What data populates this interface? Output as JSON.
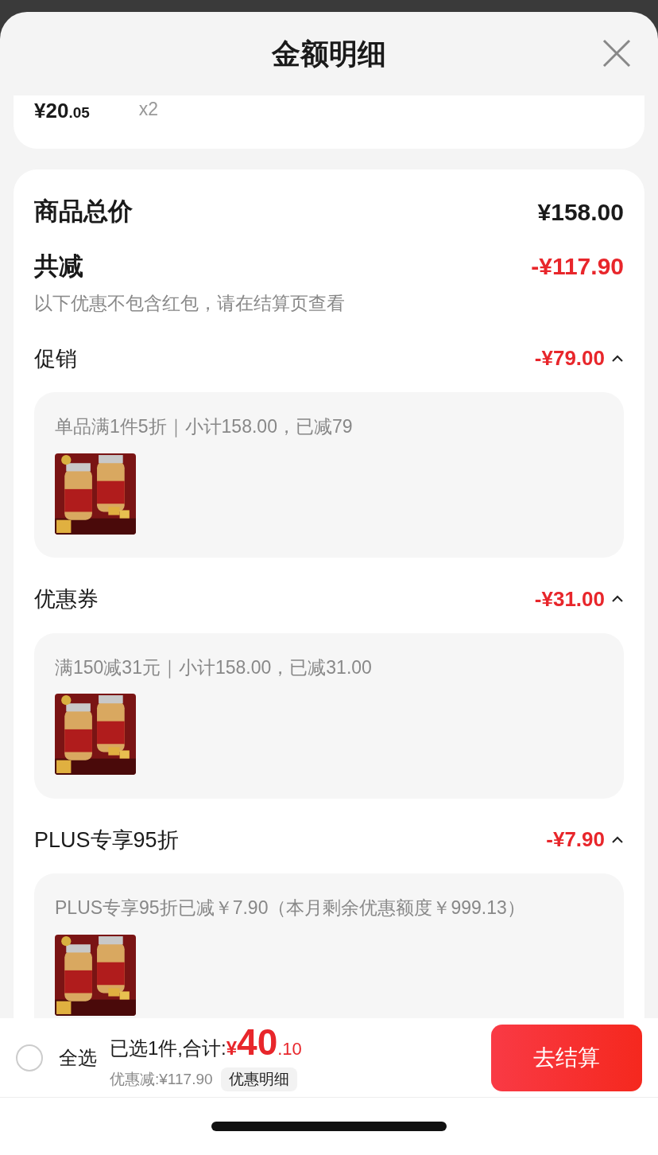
{
  "header": {
    "title": "金额明细"
  },
  "item": {
    "price_main": "¥20",
    "price_decimal": ".05",
    "quantity": "x2"
  },
  "summary": {
    "total_label": "商品总价",
    "total_value": "¥158.00",
    "reduction_label": "共减",
    "reduction_value": "-¥117.90",
    "note": "以下优惠不包含红包，请在结算页查看"
  },
  "discounts": [
    {
      "label": "促销",
      "amount": "-¥79.00",
      "expanded": true,
      "detail": "单品满1件5折｜小计158.00，已减79"
    },
    {
      "label": "优惠券",
      "amount": "-¥31.00",
      "expanded": true,
      "detail": "满150减31元｜小计158.00，已减31.00"
    },
    {
      "label": "PLUS专享95折",
      "amount": "-¥7.90",
      "expanded": true,
      "detail": "PLUS专享95折已减￥7.90（本月剩余优惠额度￥999.13）"
    }
  ],
  "footer": {
    "select_all": {
      "label": "全选",
      "checked": false
    },
    "summary_prefix": "已选1件,合计:",
    "currency": "¥",
    "total_main": "40",
    "total_decimal": ".10",
    "saving": "优惠减:¥117.90",
    "details_link": "优惠明细",
    "checkout": "去结算"
  }
}
